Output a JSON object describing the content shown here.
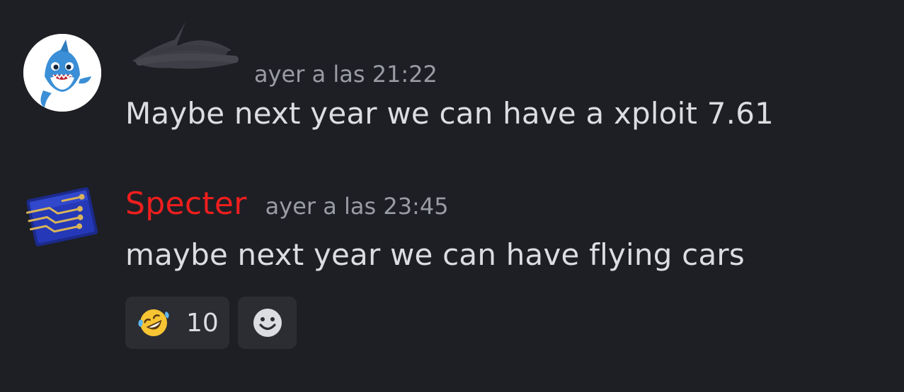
{
  "messages": [
    {
      "author": "",
      "author_redacted": true,
      "avatar": "baby-shark-avatar",
      "timestamp": "ayer a las 21:22",
      "content": "Maybe next year we can have a xploit 7.61"
    },
    {
      "author": "Specter",
      "author_color": "#f01e1e",
      "avatar": "circuit-board-avatar",
      "timestamp": "ayer a las 23:45",
      "content": "maybe next year we can have flying cars",
      "reactions": [
        {
          "emoji": "rolling-on-floor-laughing-icon",
          "count": "10"
        }
      ],
      "add_reaction_icon": "smiley-add-reaction-icon"
    }
  ],
  "colors": {
    "background": "#1e1f24",
    "text": "#dcdde1",
    "timestamp": "#9a9ca4",
    "reaction_bg": "#2b2d33"
  }
}
